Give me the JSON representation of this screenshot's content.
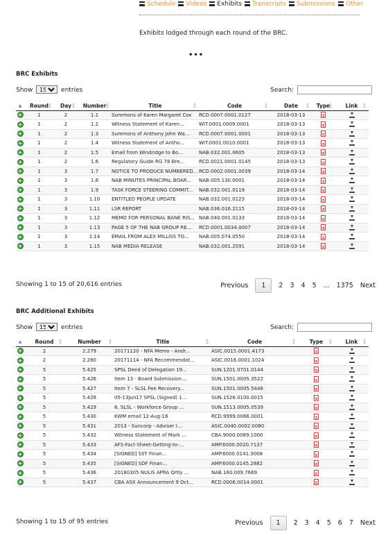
{
  "nav": {
    "items": [
      {
        "label": "Schedule",
        "current": false
      },
      {
        "label": "Videos",
        "current": false
      },
      {
        "label": "Exhibits",
        "current": true
      },
      {
        "label": "Transcripts",
        "current": false
      },
      {
        "label": "Submissions",
        "current": false
      },
      {
        "label": "Other",
        "current": false
      }
    ]
  },
  "intro_text": "Exhibits lodged through each round of the BRC.",
  "more_dots": "•••",
  "colors": {
    "accent": "#e8912b",
    "add_button": "#3a9a3a",
    "pdf": "#d33333"
  },
  "exhibits": {
    "title": "BRC Exhibits",
    "show_label": "Show",
    "entries_label": "entries",
    "page_size": "15",
    "search_label": "Search:",
    "search_value": "",
    "headers": [
      "Round",
      "Day",
      "Number",
      "Title",
      "Code",
      "Date",
      "Type",
      "Link"
    ],
    "rows": [
      {
        "round": "1",
        "day": "2",
        "number": "1.1",
        "title": "Summons of Karen Margaret Cox",
        "code": "RCD.0007.0001.0127",
        "date": "2018-03-13"
      },
      {
        "round": "1",
        "day": "2",
        "number": "1.2",
        "title": "Witness Statement of Karen...",
        "code": "WIT.0001.0009.0001",
        "date": "2018-03-13"
      },
      {
        "round": "1",
        "day": "2",
        "number": "1.3",
        "title": "Summons of Anthony John Wa...",
        "code": "RCD.0007.0001.0001",
        "date": "2018-03-13"
      },
      {
        "round": "1",
        "day": "2",
        "number": "1.4",
        "title": "Witness Statement of Antho...",
        "code": "WIT.0001.0010.0001",
        "date": "2018-03-13"
      },
      {
        "round": "1",
        "day": "2",
        "number": "1.5",
        "title": "Email from Windridge to Bo...",
        "code": "NAB.032.001.0605",
        "date": "2018-03-13"
      },
      {
        "round": "1",
        "day": "2",
        "number": "1.6",
        "title": "Regulatory Guide RG 78 Bre...",
        "code": "RCD.0021.0001.0145",
        "date": "2018-03-13"
      },
      {
        "round": "1",
        "day": "3",
        "number": "1.7",
        "title": "NOTICE TO PRODUCE NUMBERED...",
        "code": "RCD.0002.0001.0039",
        "date": "2018-03-14"
      },
      {
        "round": "1",
        "day": "3",
        "number": "1.8",
        "title": "NAB MINUTES PRINCIPAL BOAR...",
        "code": "NAB.005.130.0001",
        "date": "2018-03-14"
      },
      {
        "round": "1",
        "day": "3",
        "number": "1.9",
        "title": "TASK FORCE STEERING COMMIT...",
        "code": "NAB.032.001.0119",
        "date": "2018-03-14"
      },
      {
        "round": "1",
        "day": "3",
        "number": "1.10",
        "title": "ENTITLED PEOPLE UPDATE",
        "code": "NAB.032.001.0123",
        "date": "2018-03-14"
      },
      {
        "round": "1",
        "day": "3",
        "number": "1.11",
        "title": "LSR REPORT",
        "code": "NAB.036.016.2115",
        "date": "2018-03-14"
      },
      {
        "round": "1",
        "day": "3",
        "number": "1.12",
        "title": "MEMO FOR PERSONAL BANK RIS...",
        "code": "NAB.040.001.0133",
        "date": "2018-03-14"
      },
      {
        "round": "1",
        "day": "3",
        "number": "1.13",
        "title": "PAGE 5 OF THE NAB GROUP RE...",
        "code": "RCD.0001.0034.0007",
        "date": "2018-03-14"
      },
      {
        "round": "1",
        "day": "3",
        "number": "1.14",
        "title": "EMAIL FROM ALEX MILLISS TO...",
        "code": "NAB.005.074.0550",
        "date": "2018-03-14"
      },
      {
        "round": "1",
        "day": "3",
        "number": "1.15",
        "title": "NAB MEDIA RELEASE",
        "code": "NAB.032.001.2591",
        "date": "2018-03-14"
      }
    ],
    "info": "Showing 1 to 15 of 20,616 entries",
    "pager": [
      "Previous",
      "1",
      "2",
      "3",
      "4",
      "5",
      "...",
      "1375",
      "Next"
    ]
  },
  "additional": {
    "title": "BRC Additional Exhibits",
    "show_label": "Show",
    "entries_label": "entries",
    "page_size": "15",
    "search_label": "Search:",
    "search_value": "",
    "headers": [
      "Round",
      "Number",
      "Title",
      "Code",
      "Type",
      "Link"
    ],
    "rows": [
      {
        "round": "2",
        "number": "2.279",
        "title": "20171120 - NFA Memo - Andr...",
        "code": "ASIC.0015.0001.4173"
      },
      {
        "round": "2",
        "number": "2.280",
        "title": "20171114 - NFA Recommendat...",
        "code": "ASIC.0016.0001.1024"
      },
      {
        "round": "5",
        "number": "5.425",
        "title": "SPSL Deed of Delegation 19...",
        "code": "SUN.1201.0701.0144"
      },
      {
        "round": "5",
        "number": "5.426",
        "title": "Item 13 - Board Submission...",
        "code": "SUN.1501.0005.3522"
      },
      {
        "round": "5",
        "number": "5.427",
        "title": "Item 7 - SLSL Fee Recovery...",
        "code": "SUN.1501.0005.5446"
      },
      {
        "round": "5",
        "number": "5.428",
        "title": "05-13Jun17 SPSL (Signed) 1...",
        "code": "SUN.1526.0100.0015"
      },
      {
        "round": "5",
        "number": "5.429",
        "title": "6. SLSL - Workforce Group ...",
        "code": "SUN.1513.0005.0539"
      },
      {
        "round": "5",
        "number": "5.430",
        "title": "KWM email 12-Aug-18",
        "code": "RCD.9999.0066.0001"
      },
      {
        "round": "5",
        "number": "5.431",
        "title": "2013 - Suncorp - Adviser I...",
        "code": "ASIC.0040.0002.0080"
      },
      {
        "round": "5",
        "number": "5.432",
        "title": "Witness Statement of Mark ...",
        "code": "CBA.9000.0089.1000"
      },
      {
        "round": "5",
        "number": "5.433",
        "title": "AFS-Fact-Sheet-Getting-to-...",
        "code": "AMP.6000.0020.7137"
      },
      {
        "round": "5",
        "number": "5.434",
        "title": "[SIGNED] SST Finan...",
        "code": "AMP.6000.0141.3008"
      },
      {
        "round": "5",
        "number": "5.435",
        "title": "[SIGNED] SDF Finan...",
        "code": "AMP.6000.0145.2882"
      },
      {
        "round": "5",
        "number": "5.436",
        "title": "20180305 NULIS APRA Qrtly ...",
        "code": "NAB.160.009.7669"
      },
      {
        "round": "5",
        "number": "5.437",
        "title": "CBA ASX Announcement 9 Oct...",
        "code": "RCD.0006.0014.0001"
      }
    ],
    "info": "Showing 1 to 15 of 95 entries",
    "pager": [
      "Previous",
      "1",
      "2",
      "3",
      "4",
      "5",
      "6",
      "7",
      "Next"
    ]
  }
}
